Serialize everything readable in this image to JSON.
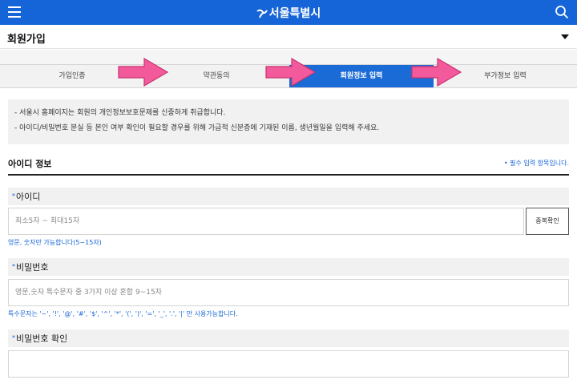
{
  "header": {
    "brand": "서울특별시",
    "menu_icon": "hamburger-menu-icon",
    "search_icon": "search-icon",
    "color": "#1565d8"
  },
  "page": {
    "title": "회원가입",
    "dropdown_icon": "caret-down-icon"
  },
  "steps": [
    {
      "label": "가입인증"
    },
    {
      "label": "약관동의"
    },
    {
      "label": "회원정보 입력",
      "active": true
    },
    {
      "label": "부가정보 입력"
    }
  ],
  "annotation": {
    "arrow_color": "#f25a9b",
    "arrow_icon": "pink-arrow-icon"
  },
  "notice": [
    "- 서울시 홈페이지는 회원의 개인정보보호문제를 신중하게 취급합니다.",
    "- 아이디/비밀번호 분실 등 본인 여부 확인이 필요할 경우를 위해 가급적 신분증에 기재된 이름, 생년월일을 입력해 주세요."
  ],
  "section": {
    "title": "아이디 정보",
    "required_note": "• 필수 입력 항목입니다."
  },
  "fields": {
    "id": {
      "label": "아이디",
      "placeholder": "최소5자 ~ 최대15자",
      "button": "중복확인",
      "hint": "영문, 숫자만 가능합니다(5~15자)"
    },
    "password": {
      "label": "비밀번호",
      "placeholder": "영문,숫자 특수문자 중 3가지 이상 혼합 9~15자",
      "hint": "특수문자는 '~', '!', '@', '#', '$', '^', '*', '(', ')', '=', '_', '.', '|' 만 사용가능합니다."
    },
    "password_confirm": {
      "label": "비밀번호 확인",
      "placeholder": ""
    },
    "required_star": "*"
  }
}
